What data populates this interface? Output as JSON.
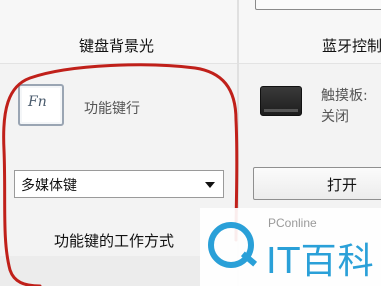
{
  "top": {
    "left_caption": "键盘背景光",
    "right_caption": "蓝牙控制"
  },
  "fn_section": {
    "icon_text": "Fn",
    "title": "功能键行",
    "dropdown_value": "多媒体键",
    "caption": "功能键的工作方式"
  },
  "touchpad_section": {
    "label": "触摸板:",
    "status": "关闭",
    "button_label": "打开"
  },
  "watermark": {
    "small_text": "PConline",
    "big_text": "IT百科"
  },
  "colors": {
    "annotation_red": "#c0201a",
    "brand_blue": "#2aa0d8"
  }
}
